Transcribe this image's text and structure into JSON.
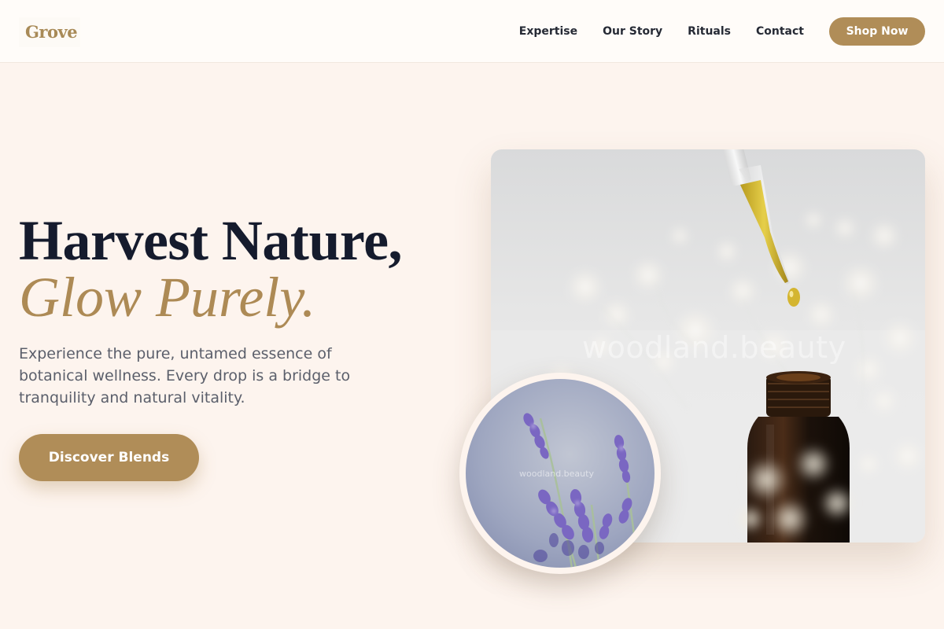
{
  "brand": {
    "name": "Grove"
  },
  "nav": {
    "items": [
      {
        "label": "Expertise"
      },
      {
        "label": "Our Story"
      },
      {
        "label": "Rituals"
      },
      {
        "label": "Contact"
      }
    ],
    "shop_label": "Shop Now"
  },
  "hero": {
    "headline_line1": "Harvest Nature,",
    "headline_line2": "Glow Purely.",
    "subtext": "Experience the pure, untamed essence of botanical wellness. Every drop is a bridge to tranquility and natural vitality.",
    "cta_label": "Discover Blends"
  },
  "images": {
    "main_watermark": "woodland.beauty",
    "circle_watermark": "woodland.beauty",
    "main_icon": "dropper-bottle-photo",
    "circle_icon": "lavender-photo"
  },
  "colors": {
    "accent": "#b08d58",
    "background": "#fdf4ee",
    "heading": "#151b2d",
    "body_text": "#5b5f6b"
  }
}
